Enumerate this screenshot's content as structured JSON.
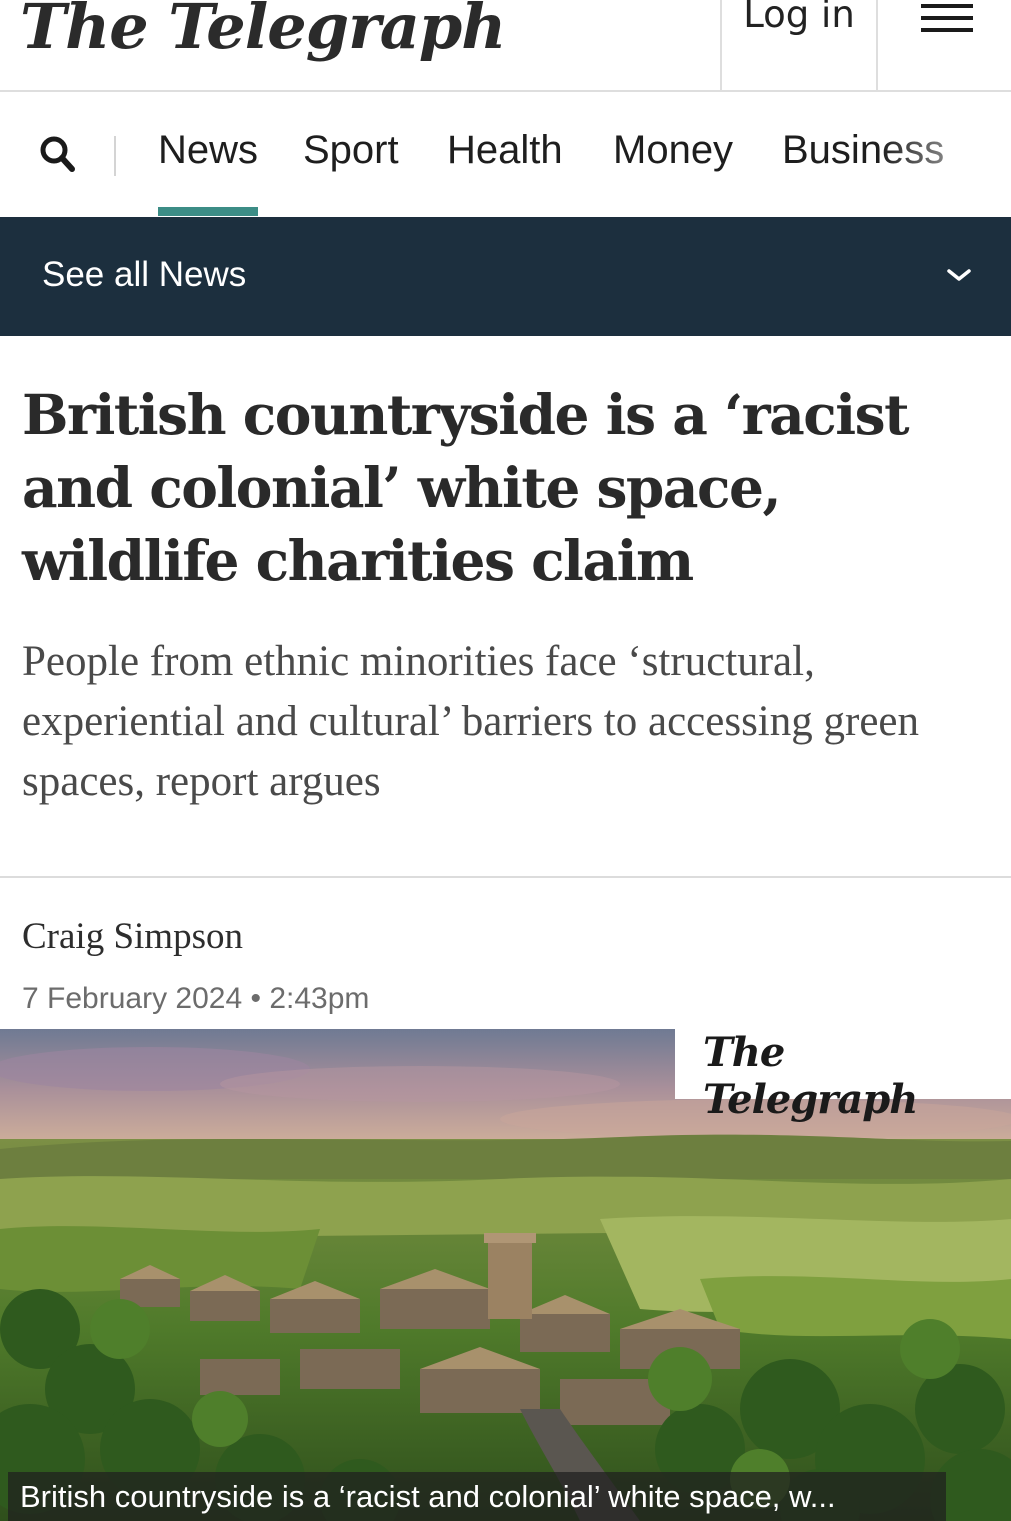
{
  "masthead": {
    "logo_text": "The Telegraph",
    "login_label": "Log in",
    "menu_icon": "hamburger-menu-icon"
  },
  "nav": {
    "search_icon": "search-icon",
    "items": [
      {
        "label": "News",
        "active": true
      },
      {
        "label": "Sport"
      },
      {
        "label": "Health"
      },
      {
        "label": "Money"
      },
      {
        "label": "Business"
      }
    ],
    "accent_color": "#3c8d86"
  },
  "section_bar": {
    "label": "See all News",
    "icon": "chevron-down-icon",
    "background": "#1c2f3e"
  },
  "article": {
    "headline": "British countryside is a ‘racist and colonial’ white space, wildlife charities claim",
    "standfirst": "People from ethnic minorities face ‘structural, experiential and cultural’ barriers to accessing green spaces, report argues",
    "author": "Craig Simpson",
    "date": "7 February 2024",
    "separator": "•",
    "time": "2:43pm"
  },
  "image": {
    "watermark": "The Telegraph",
    "caption": "British countryside is a ‘racist and colonial’ white space, w..."
  }
}
